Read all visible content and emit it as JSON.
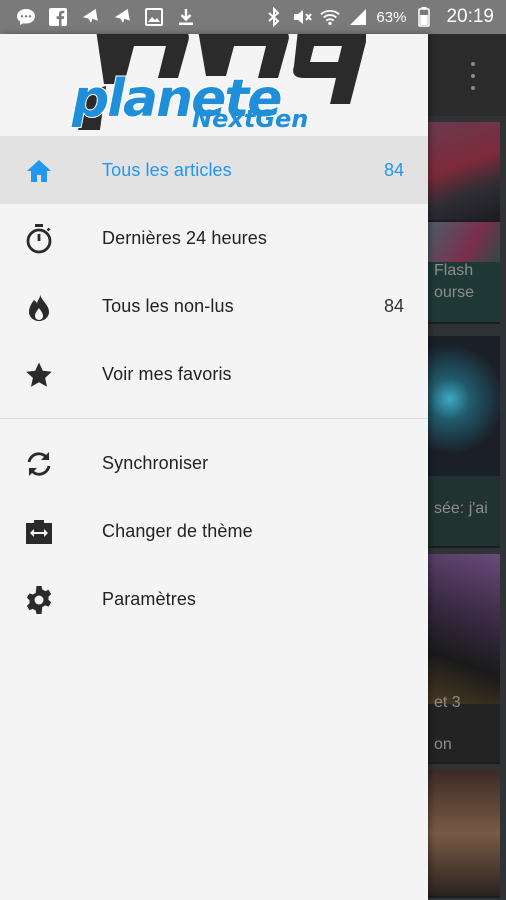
{
  "status_bar": {
    "battery_percent": "63%",
    "time": "20:19",
    "left_icons": [
      "messenger-icon",
      "facebook-icon",
      "plane-icon",
      "plane-icon",
      "image-icon",
      "download-icon"
    ],
    "right_icons": [
      "bluetooth-icon",
      "mute-icon",
      "wifi-icon",
      "signal-icon",
      "battery-icon"
    ]
  },
  "background_cards": [
    {
      "text": ""
    },
    {
      "text": "Flash",
      "text2": "ourse"
    },
    {
      "text": "sée: j'ai"
    },
    {
      "text": "et 3",
      "text2": "on"
    },
    {
      "text": ""
    }
  ],
  "drawer": {
    "logo": {
      "line1": "pnq",
      "line2": "planete",
      "line3": "NextGen"
    },
    "items": [
      {
        "label": "Tous les articles",
        "count": "84",
        "icon": "home-icon",
        "active": true
      },
      {
        "label": "Dernières 24 heures",
        "count": "",
        "icon": "timer-icon",
        "active": false
      },
      {
        "label": "Tous les non-lus",
        "count": "84",
        "icon": "flame-icon",
        "active": false
      },
      {
        "label": "Voir mes favoris",
        "count": "",
        "icon": "star-icon",
        "active": false
      }
    ],
    "secondary_items": [
      {
        "label": "Synchroniser",
        "icon": "sync-icon"
      },
      {
        "label": "Changer de thème",
        "icon": "theme-icon"
      },
      {
        "label": "Paramètres",
        "icon": "settings-icon"
      }
    ]
  },
  "colors": {
    "accent": "#2196f3",
    "logo_blue": "#1e8fd8",
    "logo_dark": "#2b2b2b",
    "drawer_bg": "#f4f4f4",
    "active_bg": "#e2e2e2",
    "icon": "#2a2a2a"
  }
}
